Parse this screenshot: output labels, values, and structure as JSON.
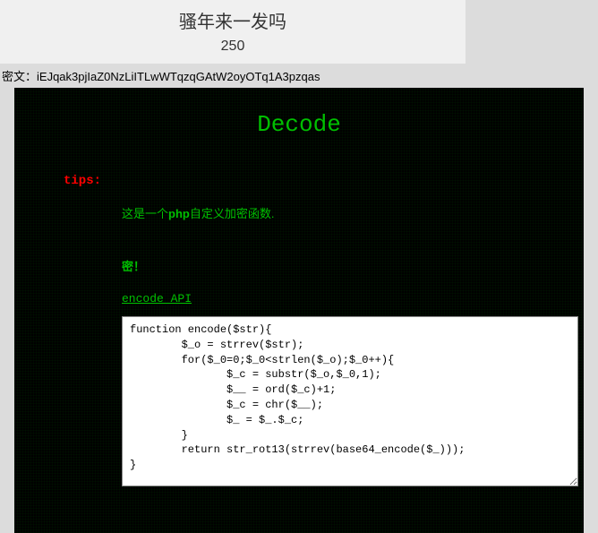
{
  "header": {
    "title": "骚年来一发吗",
    "number": "250"
  },
  "cipher": {
    "label": "密文：",
    "value": "iEJqak3pjIaZ0NzLiITLwWTqzqGAtW2oyOTq1A3pzqas"
  },
  "panel": {
    "heading": "Decode",
    "tips_label": "tips:",
    "desc_prefix": "这是一个",
    "desc_bold": "php",
    "desc_suffix": "自定义加密函数.",
    "mi": "密！",
    "api_link": "encode API",
    "code": "function encode($str){\n        $_o = strrev($str);\n        for($_0=0;$_0<strlen($_o);$_0++){\n               $_c = substr($_o,$_0,1);\n               $__ = ord($_c)+1;\n               $_c = chr($__);\n               $_ = $_.$_c;\n        }\n        return str_rot13(strrev(base64_encode($_)));\n}"
  }
}
